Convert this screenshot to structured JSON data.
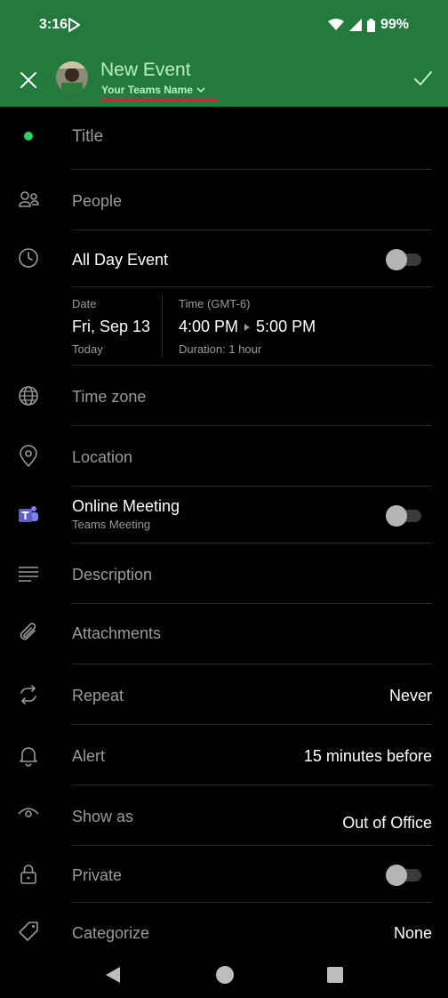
{
  "status": {
    "time": "3:16",
    "battery": "99%"
  },
  "header": {
    "title": "New Event",
    "team": "Your Teams Name"
  },
  "form": {
    "title_placeholder": "Title",
    "people": "People",
    "all_day": "All Day Event",
    "date_label": "Date",
    "date_value": "Fri, Sep 13",
    "date_sub": "Today",
    "time_label": "Time (GMT-6)",
    "time_start": "4:00 PM",
    "time_end": "5:00 PM",
    "duration": "Duration: 1 hour",
    "time_zone": "Time zone",
    "location": "Location",
    "online_meeting": "Online Meeting",
    "online_meeting_sub": "Teams Meeting",
    "description": "Description",
    "attachments": "Attachments",
    "repeat": "Repeat",
    "repeat_value": "Never",
    "alert": "Alert",
    "alert_value": "15 minutes before",
    "show_as": "Show as",
    "show_as_value": "Out of Office",
    "private": "Private",
    "categorize": "Categorize",
    "categorize_value": "None"
  },
  "colors": {
    "header_bg": "#237a3c",
    "accent_text": "#b9f0c4",
    "underline": "#d81f3b",
    "teams": "#5b5fc7"
  }
}
